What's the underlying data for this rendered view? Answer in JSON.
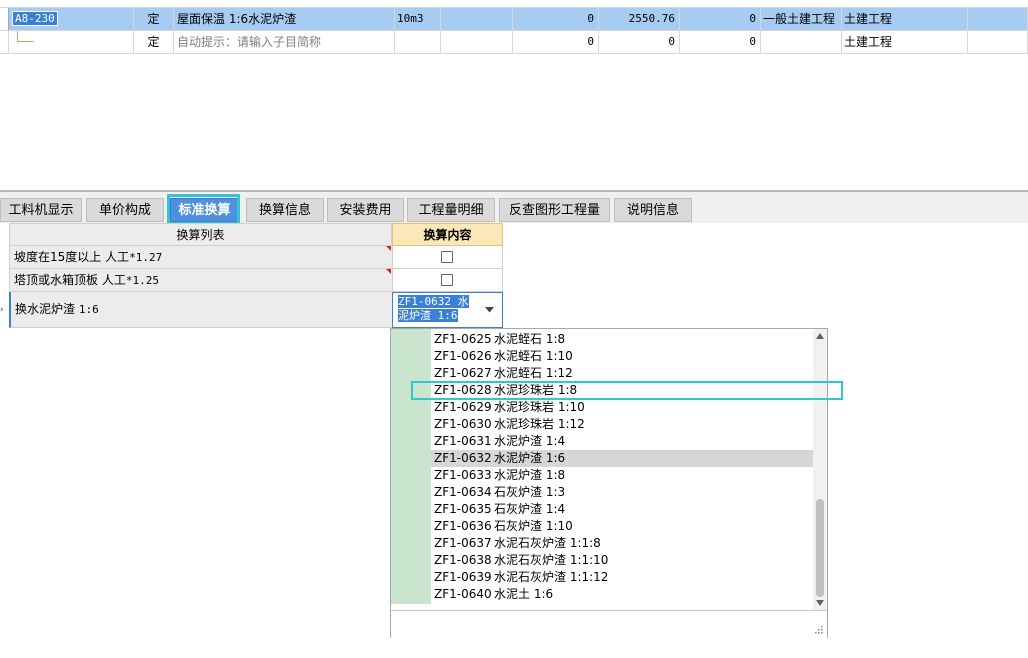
{
  "rows": [
    {
      "code": "A8-230",
      "type": "定",
      "name": "屋面保温 1:6水泥炉渣",
      "unit": "10m3",
      "qty": "0",
      "price": "2550.76",
      "total": "0",
      "cat": "一般土建工程",
      "major": "土建工程"
    },
    {
      "code": "",
      "type": "定",
      "name": "自动提示：请输入子目简称",
      "unit": "",
      "qty": "0",
      "price": "0",
      "total": "0",
      "cat": "",
      "major": "土建工程"
    }
  ],
  "tabs": [
    "工料机显示",
    "单价构成",
    "标准换算",
    "换算信息",
    "安装费用",
    "工程量明细",
    "反查图形工程量",
    "说明信息"
  ],
  "active_tab": "标准换算",
  "conv": {
    "header_list": "换算列表",
    "header_content": "换算内容",
    "items": [
      {
        "prefix": "坡度在15度以上 人工",
        "suffix": "*1.27"
      },
      {
        "prefix": "塔顶或水箱顶板 人工",
        "suffix": "*1.25"
      },
      {
        "prefix": "换水泥炉渣 ",
        "suffix": "1:6"
      }
    ],
    "selected_value": "ZF1-0632 水泥炉渣 1:6"
  },
  "dropdown": [
    {
      "code": "ZF1-0625",
      "name": "水泥蛭石 1:8"
    },
    {
      "code": "ZF1-0626",
      "name": "水泥蛭石 1:10"
    },
    {
      "code": "ZF1-0627",
      "name": "水泥蛭石 1:12"
    },
    {
      "code": "ZF1-0628",
      "name": "水泥珍珠岩 1:8"
    },
    {
      "code": "ZF1-0629",
      "name": "水泥珍珠岩 1:10"
    },
    {
      "code": "ZF1-0630",
      "name": "水泥珍珠岩 1:12"
    },
    {
      "code": "ZF1-0631",
      "name": "水泥炉渣 1:4"
    },
    {
      "code": "ZF1-0632",
      "name": "水泥炉渣 1:6"
    },
    {
      "code": "ZF1-0633",
      "name": "水泥炉渣 1:8"
    },
    {
      "code": "ZF1-0634",
      "name": "石灰炉渣 1:3"
    },
    {
      "code": "ZF1-0635",
      "name": "石灰炉渣 1:4"
    },
    {
      "code": "ZF1-0636",
      "name": "石灰炉渣 1:10"
    },
    {
      "code": "ZF1-0637",
      "name": "水泥石灰炉渣 1:1:8"
    },
    {
      "code": "ZF1-0638",
      "name": "水泥石灰炉渣 1:1:10"
    },
    {
      "code": "ZF1-0639",
      "name": "水泥石灰炉渣 1:1:12"
    },
    {
      "code": "ZF1-0640",
      "name": "水泥土 1:6"
    }
  ],
  "dropdown_selected": "ZF1-0632",
  "dropdown_highlighted": "ZF1-0628"
}
